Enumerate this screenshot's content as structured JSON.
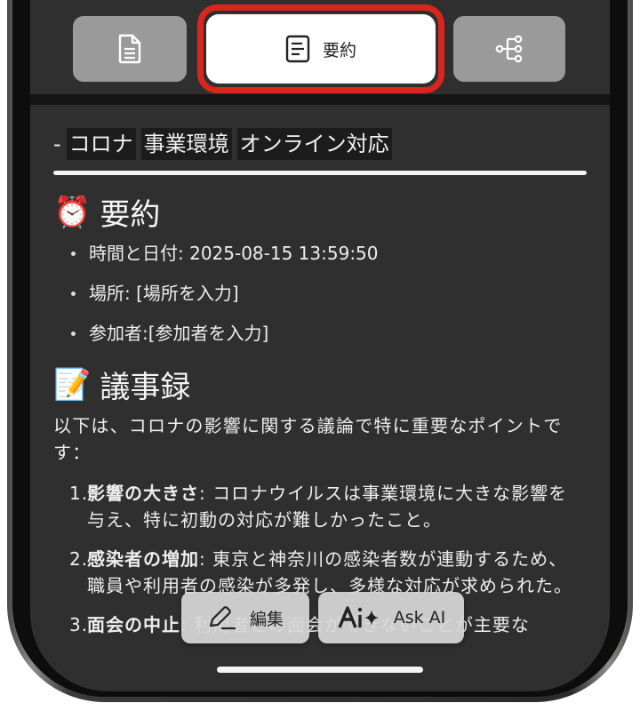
{
  "tabs": {
    "document_icon": "document-icon",
    "summary_label": "要約",
    "summary_icon": "summary-document-icon",
    "mindmap_icon": "mindmap-tree-icon"
  },
  "keywords": {
    "dash": "-",
    "items": [
      "コロナ",
      "事業環境",
      "オンライン対応"
    ]
  },
  "summary": {
    "emoji": "⏰",
    "heading": "要約",
    "bullets": [
      "時間と日付: 2025-08-15 13:59:50",
      "場所: [場所を入力]",
      "参加者:[参加者を入力]"
    ]
  },
  "minutes": {
    "emoji": "📝",
    "heading": "議事録",
    "intro": "以下は、コロナの影響に関する議論で特に重要なポイントです：",
    "items": [
      {
        "num": "1.",
        "title": "影響の大きさ",
        "text": ": コロナウイルスは事業環境に大きな影響を与え、特に初動の対応が難しかったこと。"
      },
      {
        "num": "2.",
        "title": "感染者の増加",
        "text": ": 東京と神奈川の感染者数が連動するため、職員や利用者の感染が多発し、多様な対応が求められた。"
      },
      {
        "num": "3.",
        "title": "面会の中止",
        "text": ": 利用者との面会ができないことが主要な"
      }
    ]
  },
  "floating_actions": {
    "edit_label": "編集",
    "ai_label": "Ask AI"
  },
  "colors": {
    "highlight_ring": "#d9261c",
    "screen_bg": "#2f2f2f",
    "tab_inactive": "#9a9a9a"
  }
}
